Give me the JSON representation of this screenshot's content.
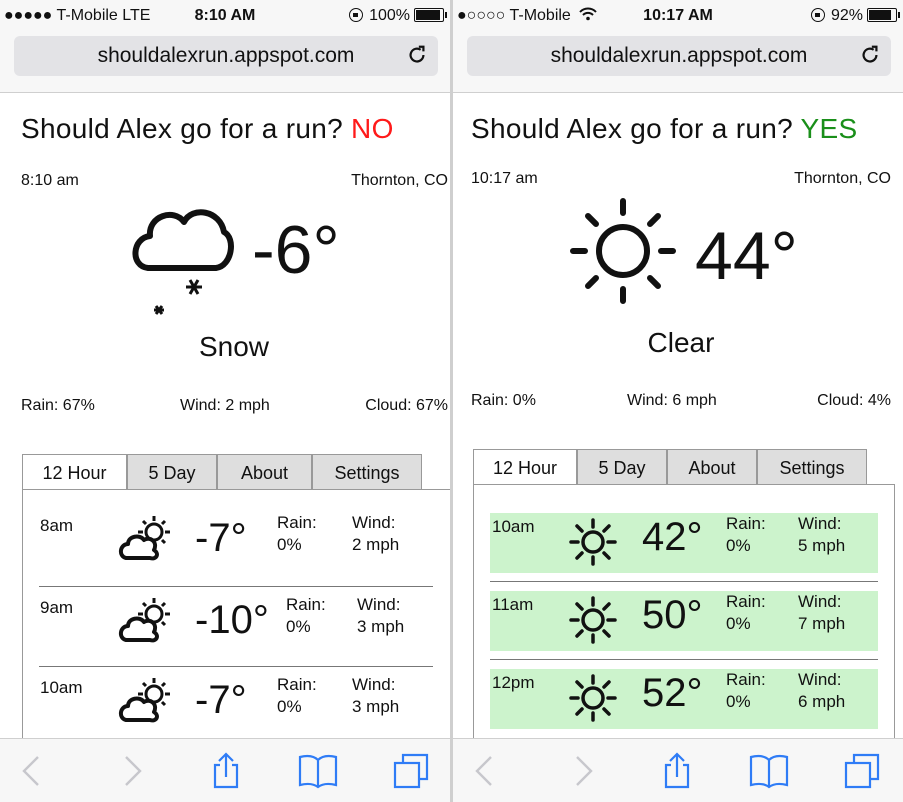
{
  "left": {
    "status": {
      "carrier": "●●●●● T-Mobile  LTE",
      "time": "8:10 AM",
      "battery": "100%",
      "battery_level": 1.0
    },
    "url": "shouldalexrun.appspot.com",
    "question": "Should Alex go for a run?",
    "answer": "NO",
    "time": "8:10 am",
    "location": "Thornton, CO",
    "current_temp": "-6°",
    "condition": "Snow",
    "rain": "Rain: 67%",
    "wind": "Wind: 2 mph",
    "cloud": "Cloud: 67%",
    "tabs": [
      "12 Hour",
      "5 Day",
      "About",
      "Settings"
    ],
    "hours": [
      {
        "time": "8am",
        "temp": "-7°",
        "rain_label": "Rain:",
        "rain": "0%",
        "wind_label": "Wind:",
        "wind": "2 mph"
      },
      {
        "time": "9am",
        "temp": "-10°",
        "rain_label": "Rain:",
        "rain": "0%",
        "wind_label": "Wind:",
        "wind": "3 mph"
      },
      {
        "time": "10am",
        "temp": "-7°",
        "rain_label": "Rain:",
        "rain": "0%",
        "wind_label": "Wind:",
        "wind": "3 mph"
      }
    ]
  },
  "right": {
    "status": {
      "carrier": "●○○○○ T-Mobile",
      "time": "10:17 AM",
      "battery": "92%",
      "battery_level": 0.92
    },
    "url": "shouldalexrun.appspot.com",
    "question": "Should Alex go for a run?",
    "answer": "YES",
    "time": "10:17 am",
    "location": "Thornton, CO",
    "current_temp": "44°",
    "condition": "Clear",
    "rain": "Rain: 0%",
    "wind": "Wind: 6 mph",
    "cloud": "Cloud: 4%",
    "tabs": [
      "12 Hour",
      "5 Day",
      "About",
      "Settings"
    ],
    "hours": [
      {
        "time": "10am",
        "temp": "42°",
        "rain_label": "Rain:",
        "rain": "0%",
        "wind_label": "Wind:",
        "wind": "5 mph"
      },
      {
        "time": "11am",
        "temp": "50°",
        "rain_label": "Rain:",
        "rain": "0%",
        "wind_label": "Wind:",
        "wind": "7 mph"
      },
      {
        "time": "12pm",
        "temp": "52°",
        "rain_label": "Rain:",
        "rain": "0%",
        "wind_label": "Wind:",
        "wind": "6 mph"
      }
    ]
  },
  "colors": {
    "no": "#ff1a1a",
    "yes": "#1a8f1a",
    "good_hour": "#ccf3cc",
    "ios_blue": "#2f7cf6"
  },
  "icons": [
    "snow-cloud-icon",
    "sun-icon",
    "partly-cloudy-icon",
    "reload-icon",
    "back-icon",
    "forward-icon",
    "share-icon",
    "bookmarks-icon",
    "tabs-icon",
    "wifi-icon"
  ]
}
